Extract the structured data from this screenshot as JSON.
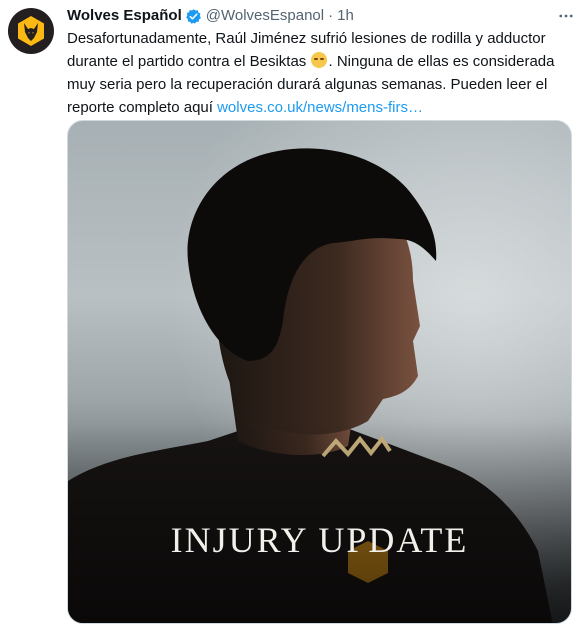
{
  "account": {
    "name": "Wolves Español",
    "handle": "@WolvesEspanol",
    "separator": "·",
    "time": "1h",
    "avatar_icon": "wolves-crest-icon",
    "verified_icon": "verified-badge-icon"
  },
  "tweet": {
    "text_part1": "Desafortunadamente, Raúl Jiménez sufrió lesiones de rodilla y adductor durante el partido contra el Besiktas ",
    "emoji_icon": "sleepy-face-emoji",
    "text_part2": ". Ninguna de ellas es considerada muy seria pero la recuperación durará algunas semanas. Pueden leer el reporte completo aquí ",
    "link": "wolves.co.uk/news/mens-firs…"
  },
  "media": {
    "title": "INJURY UPDATE"
  },
  "colors": {
    "text": "#0f1419",
    "secondary": "#536471",
    "link": "#1d9bf0",
    "verified": "#1d9bf0",
    "wolves_gold": "#fdb913"
  }
}
